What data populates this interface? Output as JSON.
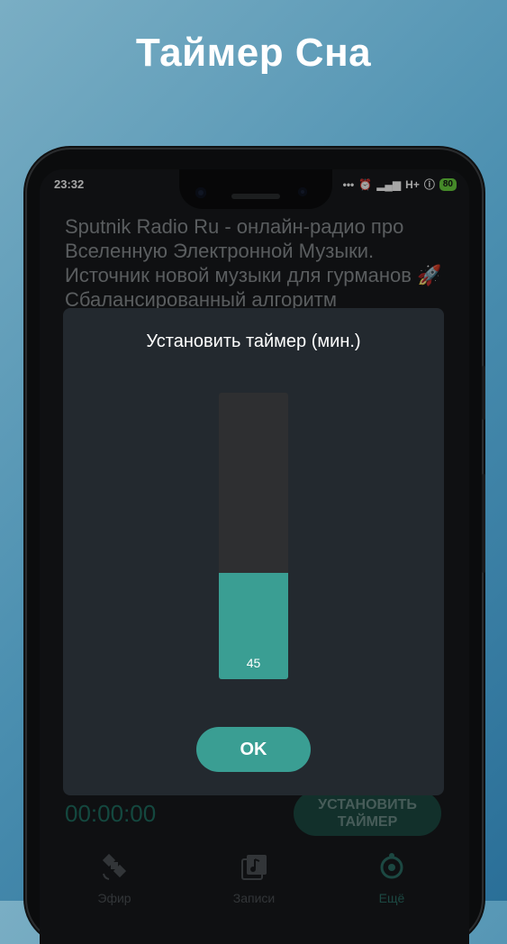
{
  "promo": {
    "title": "Таймер Сна"
  },
  "status_bar": {
    "time": "23:32",
    "network": "H+",
    "battery": "80"
  },
  "content": {
    "description": "Sputnik Radio Ru - онлайн-радио про Вселенную Электронной Музыки. Источник новой музыки для гурманов 🚀 Сбалансированный алгоритм",
    "timer_display": "00:00:00",
    "set_timer_button": "УСТАНОВИТЬ ТАЙМЕР"
  },
  "bottom_nav": {
    "items": [
      {
        "label": "Эфир",
        "icon": "satellite-icon"
      },
      {
        "label": "Записи",
        "icon": "music-note-icon"
      },
      {
        "label": "Ещё",
        "icon": "more-icon",
        "active": true
      }
    ]
  },
  "dialog": {
    "title": "Установить таймер (мин.)",
    "slider_value": "45",
    "slider_fraction": 0.37,
    "ok_label": "OK"
  },
  "colors": {
    "accent": "#3a9e93",
    "dialog_bg": "#23292f",
    "screen_bg": "#171a1c"
  }
}
